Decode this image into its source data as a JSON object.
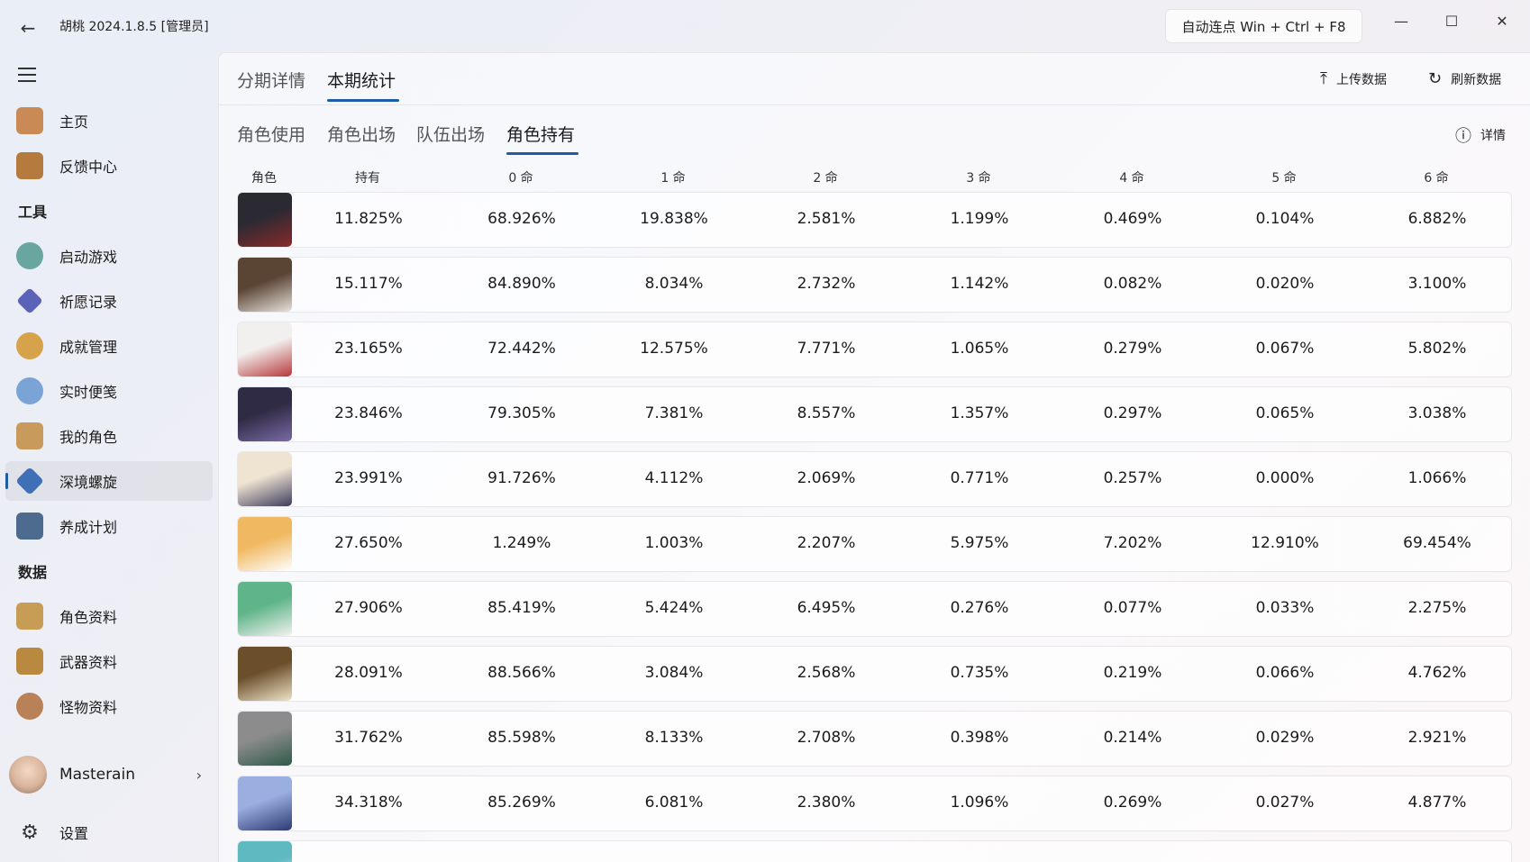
{
  "titlebar": {
    "app_title": "胡桃 2024.1.8.5 [管理员]",
    "autoclick_label": "自动连点  Win + Ctrl + F8"
  },
  "sidebar": {
    "items": [
      {
        "label": "主页",
        "icon": "home-icon",
        "color": "#c98a55"
      },
      {
        "label": "反馈中心",
        "icon": "feedback-icon",
        "color": "#b57a3e"
      },
      {
        "label": "启动游戏",
        "icon": "launch-game-icon",
        "color": "#6aa6a0"
      },
      {
        "label": "祈愿记录",
        "icon": "wish-icon",
        "color": "#5b63b8"
      },
      {
        "label": "成就管理",
        "icon": "achievement-icon",
        "color": "#d6a24a"
      },
      {
        "label": "实时便笺",
        "icon": "notes-icon",
        "color": "#7ba4d6"
      },
      {
        "label": "我的角色",
        "icon": "character-icon",
        "color": "#c89b5d"
      },
      {
        "label": "深境螺旋",
        "icon": "spiral-abyss-icon",
        "color": "#3f6fb5"
      },
      {
        "label": "养成计划",
        "icon": "plan-icon",
        "color": "#4d6a8f"
      },
      {
        "label": "角色资料",
        "icon": "character-wiki-icon",
        "color": "#c79d55"
      },
      {
        "label": "武器资料",
        "icon": "weapon-wiki-icon",
        "color": "#b9893f"
      },
      {
        "label": "怪物资料",
        "icon": "monster-wiki-icon",
        "color": "#b98157"
      }
    ],
    "sections": {
      "tools": "工具",
      "data": "数据"
    },
    "user_name": "Masterain",
    "settings_label": "设置"
  },
  "main": {
    "tabs": [
      "分期详情",
      "本期统计"
    ],
    "actions": {
      "upload": "上传数据",
      "refresh": "刷新数据",
      "details": "详情"
    },
    "subtabs": [
      "角色使用",
      "角色出场",
      "队伍出场",
      "角色持有"
    ],
    "headers": [
      "角色",
      "持有",
      "0 命",
      "1 命",
      "2 命",
      "3 命",
      "4 命",
      "5 命",
      "6 命"
    ],
    "rows": [
      {
        "portrait_colors": [
          "#2b2a33",
          "#8a2a2a"
        ],
        "values": [
          "11.825%",
          "68.926%",
          "19.838%",
          "2.581%",
          "1.199%",
          "0.469%",
          "0.104%",
          "6.882%"
        ]
      },
      {
        "portrait_colors": [
          "#5a4434",
          "#e6e2dc"
        ],
        "values": [
          "15.117%",
          "84.890%",
          "8.034%",
          "2.732%",
          "1.142%",
          "0.082%",
          "0.020%",
          "3.100%"
        ]
      },
      {
        "portrait_colors": [
          "#f2f0ee",
          "#b7373a"
        ],
        "values": [
          "23.165%",
          "72.442%",
          "12.575%",
          "7.771%",
          "1.065%",
          "0.279%",
          "0.067%",
          "5.802%"
        ]
      },
      {
        "portrait_colors": [
          "#2f2b44",
          "#7a6aa6"
        ],
        "values": [
          "23.846%",
          "79.305%",
          "7.381%",
          "8.557%",
          "1.357%",
          "0.297%",
          "0.065%",
          "3.038%"
        ]
      },
      {
        "portrait_colors": [
          "#efe4d2",
          "#3e3c5e"
        ],
        "values": [
          "23.991%",
          "91.726%",
          "4.112%",
          "2.069%",
          "0.771%",
          "0.257%",
          "0.000%",
          "1.066%"
        ]
      },
      {
        "portrait_colors": [
          "#f0b860",
          "#ffffff"
        ],
        "values": [
          "27.650%",
          "1.249%",
          "1.003%",
          "2.207%",
          "5.975%",
          "7.202%",
          "12.910%",
          "69.454%"
        ]
      },
      {
        "portrait_colors": [
          "#5fb48a",
          "#f3f3ef"
        ],
        "values": [
          "27.906%",
          "85.419%",
          "5.424%",
          "6.495%",
          "0.276%",
          "0.077%",
          "0.033%",
          "2.275%"
        ]
      },
      {
        "portrait_colors": [
          "#6b4f2a",
          "#efe3c9"
        ],
        "values": [
          "28.091%",
          "88.566%",
          "3.084%",
          "2.568%",
          "0.735%",
          "0.219%",
          "0.066%",
          "4.762%"
        ]
      },
      {
        "portrait_colors": [
          "#8c8c8c",
          "#2f5a4a"
        ],
        "values": [
          "31.762%",
          "85.598%",
          "8.133%",
          "2.708%",
          "0.398%",
          "0.214%",
          "0.029%",
          "2.921%"
        ]
      },
      {
        "portrait_colors": [
          "#9aaee0",
          "#2d3a73"
        ],
        "values": [
          "34.318%",
          "85.269%",
          "6.081%",
          "2.380%",
          "1.096%",
          "0.269%",
          "0.027%",
          "4.877%"
        ]
      },
      {
        "portrait_colors": [
          "#5fb9c0",
          "#e9f2f4"
        ],
        "values": [
          "",
          "",
          "",
          "",
          "",
          "",
          "",
          ""
        ]
      }
    ]
  }
}
